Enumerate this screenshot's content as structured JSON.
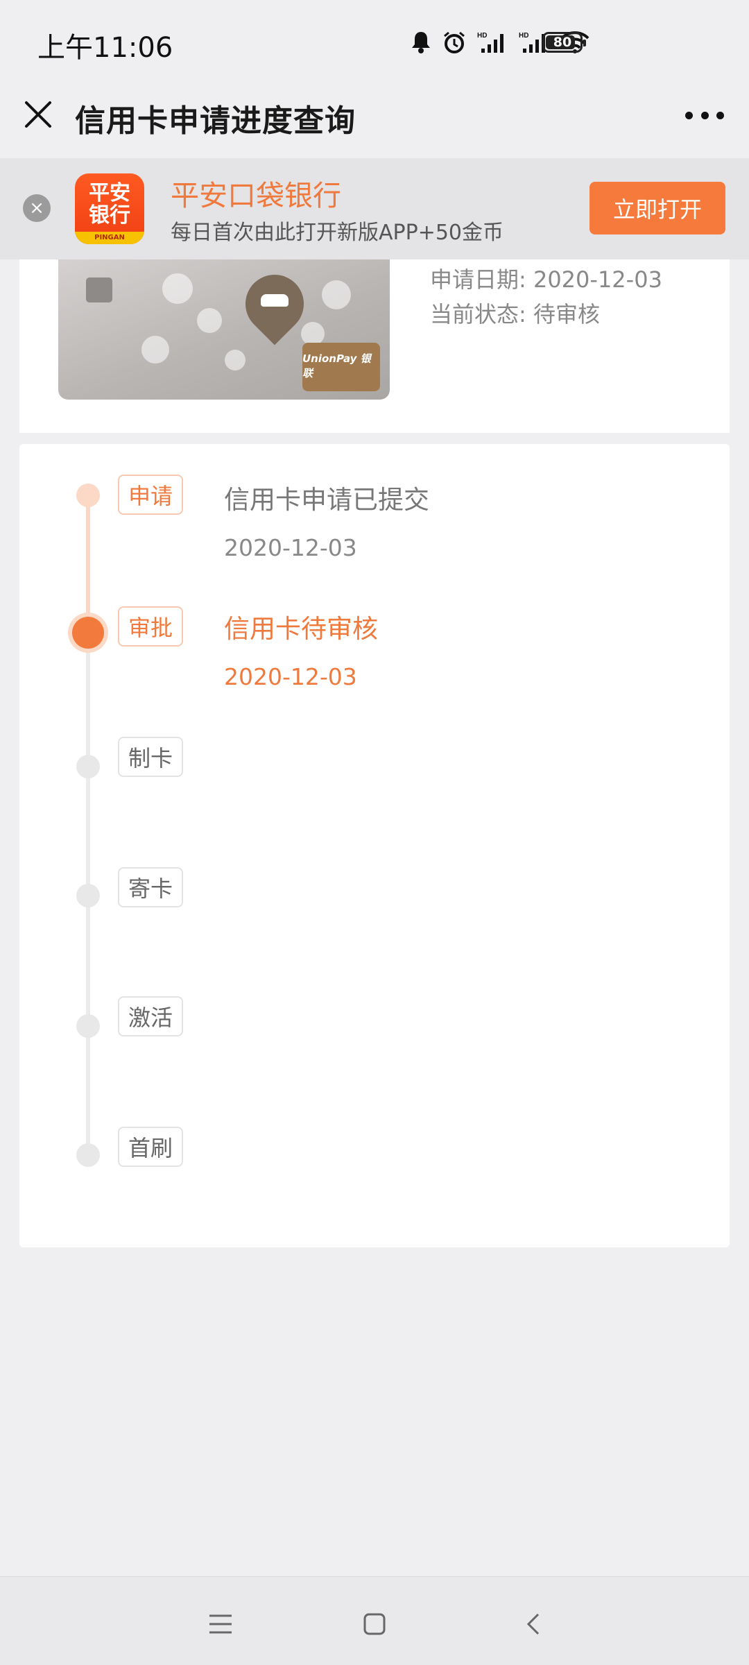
{
  "status_bar": {
    "time": "上午11:06",
    "battery_level": "80",
    "icons": [
      "bell-icon",
      "alarm-icon",
      "signal-hd-1-icon",
      "signal-hd-2-icon",
      "wifi-icon",
      "battery-icon"
    ]
  },
  "nav": {
    "title": "信用卡申请进度查询",
    "close_icon": "close-icon",
    "more_icon": "more-icon"
  },
  "promo": {
    "app_logo_line1": "平安",
    "app_logo_line2": "银行",
    "app_logo_strip": "PINGAN",
    "app_name": "平安口袋银行",
    "description": "每日首次由此打开新版APP+50金币",
    "open_button": "立即打开"
  },
  "card": {
    "brand_text": "UnionPay 银联",
    "apply_date": "申请日期: 2020-12-03",
    "current_status": "当前状态: 待审核"
  },
  "timeline": {
    "steps": [
      {
        "tag": "申请",
        "state": "done",
        "title": "信用卡申请已提交",
        "date": "2020-12-03"
      },
      {
        "tag": "审批",
        "state": "current",
        "title": "信用卡待审核",
        "date": "2020-12-03"
      },
      {
        "tag": "制卡",
        "state": "pending"
      },
      {
        "tag": "寄卡",
        "state": "pending"
      },
      {
        "tag": "激活",
        "state": "pending"
      },
      {
        "tag": "首刷",
        "state": "pending"
      }
    ]
  },
  "colors": {
    "accent": "#f57a3c",
    "background": "#efeff1",
    "pending": "#e8e8e8"
  }
}
